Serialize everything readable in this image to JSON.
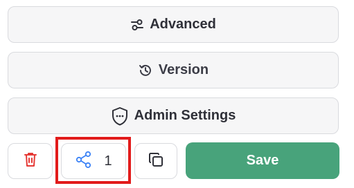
{
  "buttons": {
    "advanced_label": "Advanced",
    "version_label": "Version",
    "admin_label": "Admin Settings",
    "share_count": "1",
    "save_label": "Save"
  },
  "icons": {
    "advanced": "sliders-icon",
    "version": "history-icon",
    "admin": "shield-icon",
    "delete": "trash-icon",
    "share": "share-icon",
    "copy": "copy-icon"
  },
  "colors": {
    "save_bg": "#48a37b",
    "delete_icon": "#e53935",
    "share_icon": "#3b82f6",
    "highlight": "#e21b1b"
  }
}
